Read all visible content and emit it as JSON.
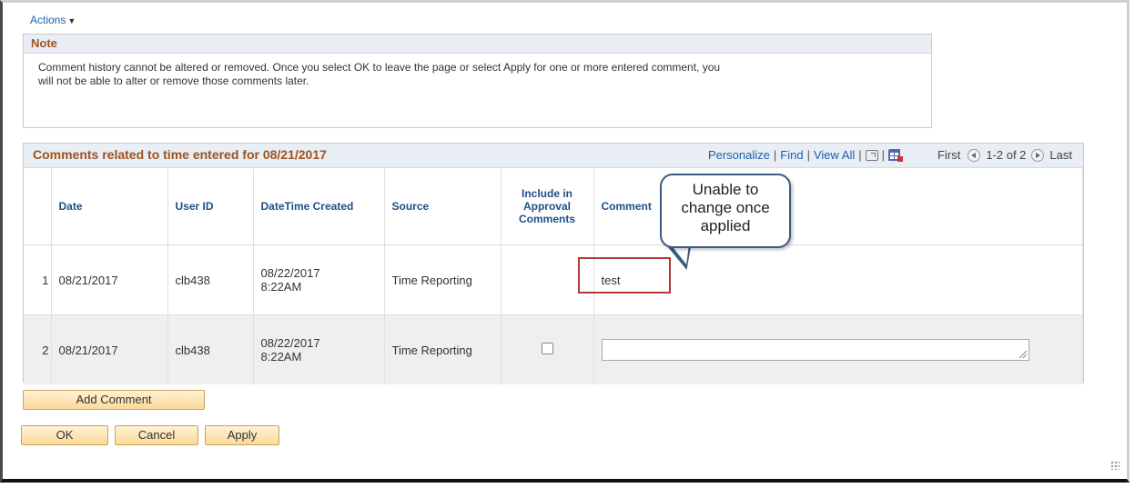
{
  "actions_label": "Actions",
  "note": {
    "title": "Note",
    "text_line1": "Comment history cannot be altered or removed. Once you select OK to leave the page or select Apply for one or more entered comment, you",
    "text_line2": "will not be able to alter or remove those comments later."
  },
  "grid": {
    "title": "Comments related to time entered for 08/21/2017",
    "personalize": "Personalize",
    "find": "Find",
    "view_all": "View All",
    "first": "First",
    "range": "1-2 of 2",
    "last": "Last",
    "columns": {
      "date": "Date",
      "user_id": "User ID",
      "datetime_created": "DateTime Created",
      "source": "Source",
      "include_l1": "Include in",
      "include_l2": "Approval",
      "include_l3": "Comments",
      "comment": "Comment"
    },
    "rows": [
      {
        "num": "1",
        "date": "08/21/2017",
        "user_id": "clb438",
        "dt_date": "08/22/2017",
        "dt_time": "8:22AM",
        "source": "Time Reporting",
        "comment": "test"
      },
      {
        "num": "2",
        "date": "08/21/2017",
        "user_id": "clb438",
        "dt_date": "08/22/2017",
        "dt_time": "8:22AM",
        "source": "Time Reporting",
        "comment": ""
      }
    ]
  },
  "callout": {
    "line1": "Unable to",
    "line2": "change once",
    "line3": "applied"
  },
  "buttons": {
    "add_comment": "Add Comment",
    "ok": "OK",
    "cancel": "Cancel",
    "apply": "Apply"
  },
  "colors": {
    "header_text": "#a0521d",
    "link": "#1f5fa8",
    "highlight": "#b23a3a",
    "callout_border": "#3c5a80"
  }
}
